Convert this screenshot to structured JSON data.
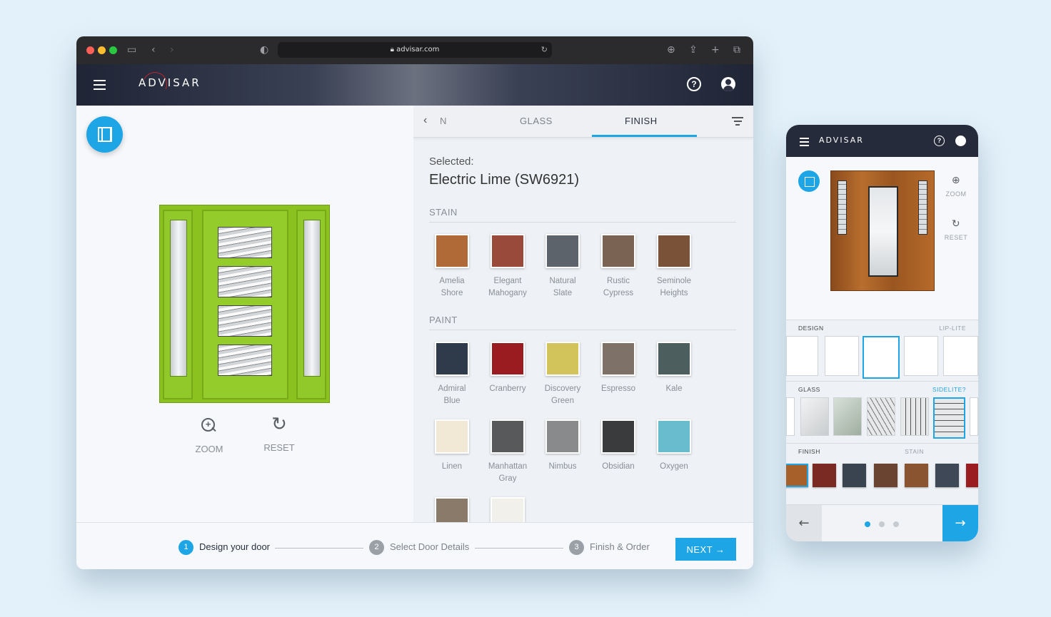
{
  "browser": {
    "url": "advisar.com",
    "brand": "ADVISAR"
  },
  "viewer": {
    "zoom_label": "ZOOM",
    "reset_label": "RESET"
  },
  "panel": {
    "tab_fragment": "N",
    "tabs": [
      {
        "label": "GLASS",
        "active": false
      },
      {
        "label": "FINISH",
        "active": true
      }
    ],
    "selected_label": "Selected:",
    "selected_name": "Electric Lime (SW6921)",
    "stain": {
      "heading": "STAIN",
      "swatches": [
        {
          "line1": "Amelia",
          "line2": "Shore",
          "color": "#b06a38"
        },
        {
          "line1": "Elegant",
          "line2": "Mahogany",
          "color": "#9a4a3a"
        },
        {
          "line1": "Natural",
          "line2": "Slate",
          "color": "#5c636b"
        },
        {
          "line1": "Rustic",
          "line2": "Cypress",
          "color": "#7a6352"
        },
        {
          "line1": "Seminole",
          "line2": "Heights",
          "color": "#7a5238"
        }
      ]
    },
    "paint": {
      "heading": "PAINT",
      "swatches": [
        {
          "line1": "Admiral",
          "line2": "Blue",
          "color": "#2f3b4a"
        },
        {
          "line1": "Cranberry",
          "line2": "",
          "color": "#9b1c20"
        },
        {
          "line1": "Discovery",
          "line2": "Green",
          "color": "#d2c45a"
        },
        {
          "line1": "Espresso",
          "line2": "",
          "color": "#7e7268"
        },
        {
          "line1": "Kale",
          "line2": "",
          "color": "#4d5e5e"
        },
        {
          "line1": "Linen",
          "line2": "",
          "color": "#f1e8d6"
        },
        {
          "line1": "Manhattan",
          "line2": "Gray",
          "color": "#58595b"
        },
        {
          "line1": "Nimbus",
          "line2": "",
          "color": "#888a8c"
        },
        {
          "line1": "Obsidian",
          "line2": "",
          "color": "#3a3b3d"
        },
        {
          "line1": "Oxygen",
          "line2": "",
          "color": "#68bccd"
        },
        {
          "line1": "",
          "line2": "",
          "color": "#8a7a6a"
        },
        {
          "line1": "",
          "line2": "",
          "color": "#f2f0ea"
        }
      ]
    }
  },
  "footer": {
    "steps": [
      {
        "num": "1",
        "label": "Design your door"
      },
      {
        "num": "2",
        "label": "Select Door Details"
      },
      {
        "num": "3",
        "label": "Finish & Order"
      }
    ],
    "next_label": "NEXT →"
  },
  "mobile": {
    "brand": "ADVISAR",
    "zoom_label": "ZOOM",
    "reset_label": "RESET",
    "design_label": "DESIGN",
    "design_right": "LIP-LITE",
    "glass_label": "GLASS",
    "glass_right": "SIDELITE?",
    "finish_label": "FINISH",
    "finish_right": "STAIN",
    "finish_colors": [
      "#a8602a",
      "#7a2a22",
      "#3a4350",
      "#6a4430",
      "#8a5430",
      "#3e4856",
      "#9b1c20"
    ]
  },
  "colors": {
    "accent": "#1ea5e6",
    "door_finish": "#8cc21f"
  }
}
